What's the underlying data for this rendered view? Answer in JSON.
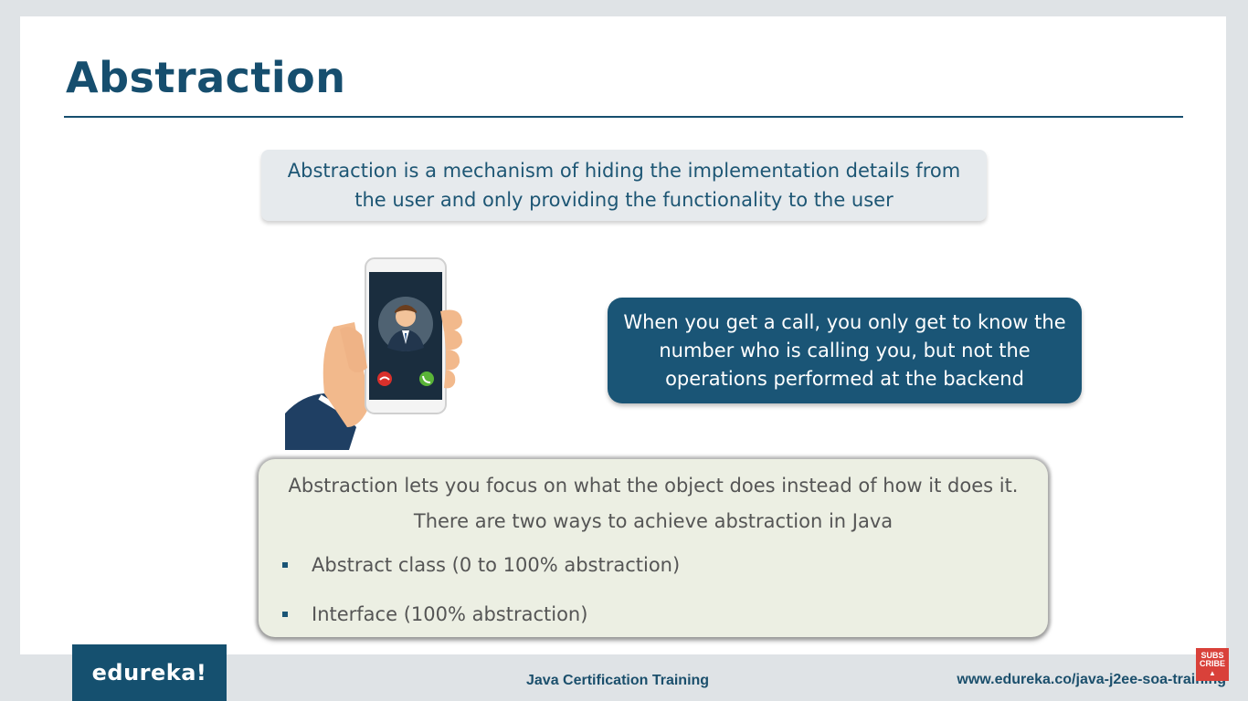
{
  "slide": {
    "title": "Abstraction",
    "definition": "Abstraction is a mechanism of hiding the implementation details from the user and only providing the functionality to the user",
    "call_example": "When you get a call, you only get to know the number who is calling you, but not the operations performed at the backend",
    "info": {
      "line1": "Abstraction lets you focus on what the object does instead of how it does it.",
      "line2": "There are two ways to achieve abstraction in Java",
      "bullets": [
        "Abstract class (0 to 100% abstraction)",
        "Interface (100% abstraction)"
      ]
    }
  },
  "footer": {
    "logo": "edureka!",
    "course": "Java Certification Training",
    "url": "www.edureka.co/java-j2ee-soa-training",
    "subscribe_label": "SUBS CRIBE"
  },
  "colors": {
    "primary": "#164e6e",
    "call_box": "#1a5576",
    "definition_box": "#e6eaed",
    "info_box": "#ecefe3",
    "subscribe_red": "#d9413a"
  }
}
